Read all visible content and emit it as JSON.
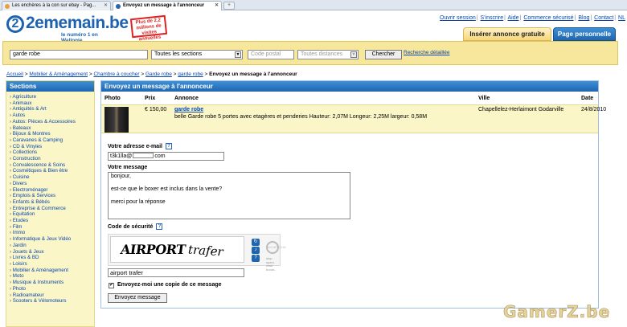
{
  "browser": {
    "tabs": [
      {
        "label": "Les enchères à la con sur ebay - Pag..."
      },
      {
        "label": "Envoyez un message à l'annonceur"
      }
    ]
  },
  "logo": {
    "name": "2ememain.be",
    "tagline": "le numéro 1 en Wallonie",
    "badge": "Plus de 2,2 millions de visites annuelles"
  },
  "toplinks": [
    "Ouvrir session",
    "S'inscrire",
    "Aide",
    "Commerce sécurisé",
    "Blog",
    "Contact",
    "NL"
  ],
  "header_buttons": {
    "insert": "Insérer annonce gratuite",
    "personal": "Page personnelle"
  },
  "search": {
    "query": "garde robe",
    "section": "Toutes les sections",
    "postal_placeholder": "Code postal",
    "distance": "Toutes distances",
    "button": "Chercher",
    "advanced_link": "Recherche détaillée"
  },
  "breadcrumb": [
    "Accueil",
    "Mobilier & Aménagement",
    "Chambre à coucher",
    "Garde robe",
    "garde robe"
  ],
  "breadcrumb_current": "Envoyez un message à l'annonceur",
  "sidebar": {
    "title": "Sections",
    "items": [
      "Agriculture",
      "Animaux",
      "Antiquités & Art",
      "Autos",
      "Autos: Pièces & Accessoires",
      "Bateaux",
      "Bijoux & Montres",
      "Caravanes & Camping",
      "CD & Vinyles",
      "Collections",
      "Construction",
      "Convalescence & Soins",
      "Cosmétiques & Bien être",
      "Cuisine",
      "Divers",
      "Electroménager",
      "Emplois & Services",
      "Enfants & Bébés",
      "Entreprise & Commerce",
      "Equitation",
      "Etudes",
      "Film",
      "Immo",
      "Informatique & Jeux Vidéo",
      "Jardin",
      "Jouets & Jeux",
      "Livres & BD",
      "Loisirs",
      "Mobilier & Aménagement",
      "Moto",
      "Musique & Instruments",
      "Photo",
      "Radioamateur",
      "Scooters & Vélomoteurs"
    ]
  },
  "main": {
    "title": "Envoyez un message à l'annonceur",
    "columns": {
      "photo": "Photo",
      "price": "Prix",
      "ad": "Annonce",
      "city": "Ville",
      "date": "Date"
    },
    "listing": {
      "price": "€ 150,00",
      "title": "garde robe",
      "description": "belle Garde robe 5 portes avec etagères et penderies Hauteur: 2,07M Longeur: 2,25M largeur: 0,58M",
      "city": "Chapellelez-Herlaimont Godarville",
      "date": "24/8/2010"
    },
    "email_label": "Votre adresse e-mail",
    "email_prefix": "t3k1lla@",
    "email_suffix": "com",
    "message_label": "Votre message",
    "message_lines": [
      "bonjour,",
      "est-ce que le boxer est inclus dans la vente?",
      "merci pour la réponse"
    ],
    "captcha_label": "Code de sécurité",
    "captcha_word1": "AIRPORT",
    "captcha_word2": "trafer",
    "captcha_answer": "airport trafer",
    "recaptcha_logo": "reCAPTCHA",
    "recaptcha_tagline": "stop spam. read books.",
    "copy_label": "Envoyez-moi une copie de ce message",
    "send_button": "Envoyez message"
  },
  "watermark": "GamerZ.be"
}
